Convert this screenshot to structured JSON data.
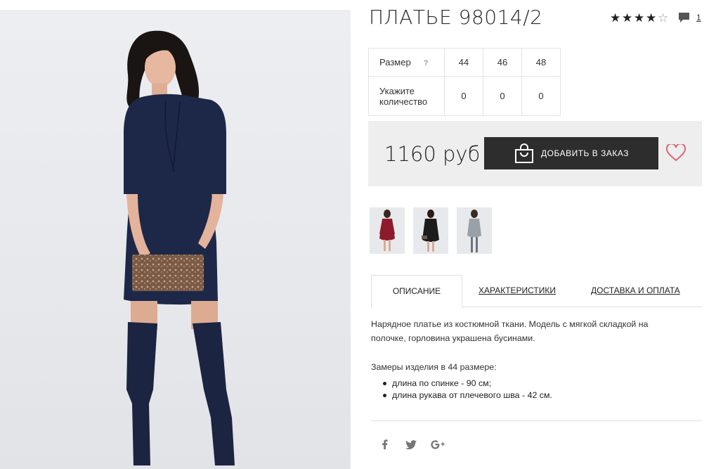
{
  "product": {
    "title": "ПЛАТЬЕ 98014/2",
    "rating": 4,
    "rating_max": 5,
    "comments_count": "1"
  },
  "sizes_table": {
    "size_label": "Размер",
    "help_mark": "?",
    "quantity_label_line1": "Укажите",
    "quantity_label_line2": "количество",
    "sizes": [
      "44",
      "46",
      "48"
    ],
    "quantities": [
      "0",
      "0",
      "0"
    ]
  },
  "purchase": {
    "price": "1160 руб",
    "add_button_label": "ДОБАВИТЬ В ЗАКАЗ",
    "add_icon": "shopping-bag-icon",
    "wishlist_icon": "heart-icon",
    "wishlist_color": "#d4687c"
  },
  "thumbnails": [
    {
      "name": "thumbnail-red-dress",
      "dress_color": "#8e1b2b"
    },
    {
      "name": "thumbnail-black-dress",
      "dress_color": "#1c1c1c"
    },
    {
      "name": "thumbnail-grey-dress",
      "dress_color": "#9aa0a8"
    }
  ],
  "main_photo": {
    "dress_color": "#1d2849",
    "background": "#e8eaee"
  },
  "tabs": [
    {
      "label": "ОПИСАНИЕ",
      "active": true
    },
    {
      "label": "ХАРАКТЕРИСТИКИ",
      "active": false
    },
    {
      "label": "ДОСТАВКА И ОПЛАТА",
      "active": false
    }
  ],
  "description": {
    "text": "Нарядное платье из костюмной ткани. Модель с мягкой складкой на полочке, горловина украшена бусинами.",
    "measures_title": "Замеры изделия в 44 размере:",
    "measures": [
      "длина по спинке - 90 см;",
      "длина рукава от плечевого шва - 42 см."
    ]
  },
  "share": [
    "facebook-icon",
    "twitter-icon",
    "google-plus-icon"
  ]
}
